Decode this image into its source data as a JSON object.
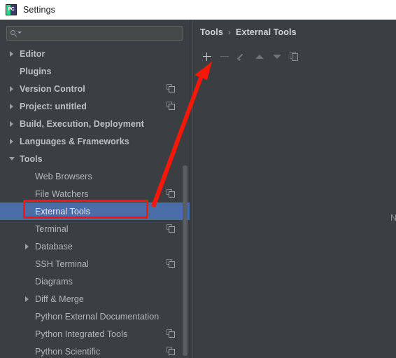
{
  "window": {
    "title": "Settings",
    "app_icon": "pycharm-pc-icon",
    "icon_text": "PC"
  },
  "search": {
    "value": "",
    "placeholder": "",
    "icon": "search-icon"
  },
  "sidebar": {
    "items": [
      {
        "label": "Editor",
        "level": "top",
        "arrow": "collapsed",
        "copy": false
      },
      {
        "label": "Plugins",
        "level": "top",
        "arrow": "none",
        "copy": false
      },
      {
        "label": "Version Control",
        "level": "top",
        "arrow": "collapsed",
        "copy": true
      },
      {
        "label": "Project: untitled",
        "level": "top",
        "arrow": "collapsed",
        "copy": true
      },
      {
        "label": "Build, Execution, Deployment",
        "level": "top",
        "arrow": "collapsed",
        "copy": false
      },
      {
        "label": "Languages & Frameworks",
        "level": "top",
        "arrow": "collapsed",
        "copy": false
      },
      {
        "label": "Tools",
        "level": "top",
        "arrow": "expanded",
        "copy": false
      },
      {
        "label": "Web Browsers",
        "level": "sub",
        "arrow": "none",
        "copy": false
      },
      {
        "label": "File Watchers",
        "level": "sub",
        "arrow": "none",
        "copy": true
      },
      {
        "label": "External Tools",
        "level": "sub",
        "arrow": "none",
        "copy": false,
        "selected": true,
        "highlighted": true
      },
      {
        "label": "Terminal",
        "level": "sub",
        "arrow": "none",
        "copy": true
      },
      {
        "label": "Database",
        "level": "sub",
        "arrow": "collapsed",
        "copy": false
      },
      {
        "label": "SSH Terminal",
        "level": "sub",
        "arrow": "none",
        "copy": true
      },
      {
        "label": "Diagrams",
        "level": "sub",
        "arrow": "none",
        "copy": false
      },
      {
        "label": "Diff & Merge",
        "level": "sub",
        "arrow": "collapsed",
        "copy": false
      },
      {
        "label": "Python External Documentation",
        "level": "sub",
        "arrow": "none",
        "copy": false
      },
      {
        "label": "Python Integrated Tools",
        "level": "sub",
        "arrow": "none",
        "copy": true
      },
      {
        "label": "Python Scientific",
        "level": "sub",
        "arrow": "none",
        "copy": true
      }
    ],
    "scrollbar": "vertical-scrollbar"
  },
  "main": {
    "breadcrumb": {
      "parent": "Tools",
      "separator": "›",
      "current": "External Tools"
    },
    "toolbar": [
      {
        "name": "add-button",
        "icon": "plus-icon",
        "enabled": true
      },
      {
        "name": "remove-button",
        "icon": "minus-icon",
        "enabled": false
      },
      {
        "name": "edit-button",
        "icon": "pencil-icon",
        "enabled": false
      },
      {
        "name": "move-up-button",
        "icon": "arrow-up-icon",
        "enabled": false
      },
      {
        "name": "move-down-button",
        "icon": "arrow-down-icon",
        "enabled": false
      },
      {
        "name": "copy-button",
        "icon": "copy-icon",
        "enabled": false
      }
    ],
    "clipped_text": "N",
    "tool_list_empty": true
  },
  "annotations": {
    "highlight_rect_label": "External Tools",
    "arrow_label": "points-to-add-button",
    "color": "#fb1707"
  },
  "colors": {
    "titlebar_bg": "#ffffff",
    "panel_bg": "#3c3f41",
    "selection_blue": "#4a6daa",
    "text": "#b4b7b9",
    "annotation_red": "#fb1707"
  }
}
